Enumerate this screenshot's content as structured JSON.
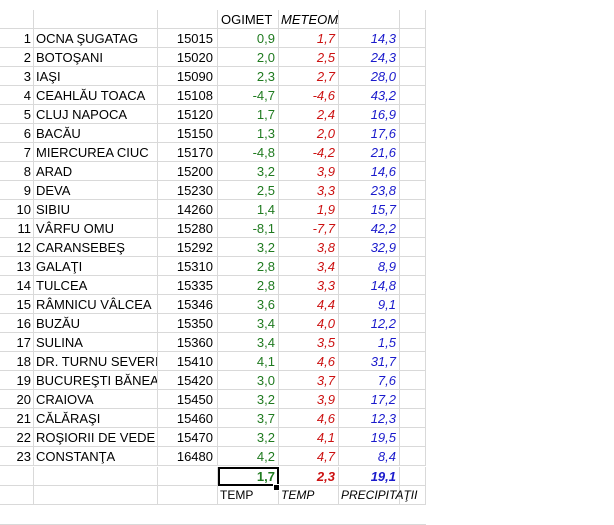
{
  "header": {
    "ogimet_label": "OGIMET",
    "meteomanz_label": "METEOMANZ"
  },
  "rows": [
    {
      "n": "1",
      "station": "OCNA ŞUGATAG",
      "code": "15015",
      "ogimet": "0,9",
      "meteomanz": "1,7",
      "precip": "14,3"
    },
    {
      "n": "2",
      "station": "BOTOŞANI",
      "code": "15020",
      "ogimet": "2,0",
      "meteomanz": "2,5",
      "precip": "24,3"
    },
    {
      "n": "3",
      "station": "IAŞI",
      "code": "15090",
      "ogimet": "2,3",
      "meteomanz": "2,7",
      "precip": "28,0"
    },
    {
      "n": "4",
      "station": "CEAHLĂU TOACA",
      "code": "15108",
      "ogimet": "-4,7",
      "meteomanz": "-4,6",
      "precip": "43,2"
    },
    {
      "n": "5",
      "station": "CLUJ NAPOCA",
      "code": "15120",
      "ogimet": "1,7",
      "meteomanz": "2,4",
      "precip": "16,9"
    },
    {
      "n": "6",
      "station": "BACĂU",
      "code": "15150",
      "ogimet": "1,3",
      "meteomanz": "2,0",
      "precip": "17,6"
    },
    {
      "n": "7",
      "station": "MIERCUREA CIUC",
      "code": "15170",
      "ogimet": "-4,8",
      "meteomanz": "-4,2",
      "precip": "21,6"
    },
    {
      "n": "8",
      "station": "ARAD",
      "code": "15200",
      "ogimet": "3,2",
      "meteomanz": "3,9",
      "precip": "14,6"
    },
    {
      "n": "9",
      "station": "DEVA",
      "code": "15230",
      "ogimet": "2,5",
      "meteomanz": "3,3",
      "precip": "23,8"
    },
    {
      "n": "10",
      "station": "SIBIU",
      "code": "14260",
      "ogimet": "1,4",
      "meteomanz": "1,9",
      "precip": "15,7"
    },
    {
      "n": "11",
      "station": "VÂRFU OMU",
      "code": "15280",
      "ogimet": "-8,1",
      "meteomanz": "-7,7",
      "precip": "42,2"
    },
    {
      "n": "12",
      "station": "CARANSEBEŞ",
      "code": "15292",
      "ogimet": "3,2",
      "meteomanz": "3,8",
      "precip": "32,9"
    },
    {
      "n": "13",
      "station": "GALAŢI",
      "code": "15310",
      "ogimet": "2,8",
      "meteomanz": "3,4",
      "precip": "8,9"
    },
    {
      "n": "14",
      "station": "TULCEA",
      "code": "15335",
      "ogimet": "2,8",
      "meteomanz": "3,3",
      "precip": "14,8"
    },
    {
      "n": "15",
      "station": "RÂMNICU VÂLCEA",
      "code": "15346",
      "ogimet": "3,6",
      "meteomanz": "4,4",
      "precip": "9,1"
    },
    {
      "n": "16",
      "station": "BUZĂU",
      "code": "15350",
      "ogimet": "3,4",
      "meteomanz": "4,0",
      "precip": "12,2"
    },
    {
      "n": "17",
      "station": "SULINA",
      "code": "15360",
      "ogimet": "3,4",
      "meteomanz": "3,5",
      "precip": "1,5"
    },
    {
      "n": "18",
      "station": "DR. TURNU SEVERIN",
      "code": "15410",
      "ogimet": "4,1",
      "meteomanz": "4,6",
      "precip": "31,7"
    },
    {
      "n": "19",
      "station": "BUCUREŞTI BĂNEASA",
      "code": "15420",
      "ogimet": "3,0",
      "meteomanz": "3,7",
      "precip": "7,6"
    },
    {
      "n": "20",
      "station": "CRAIOVA",
      "code": "15450",
      "ogimet": "3,2",
      "meteomanz": "3,9",
      "precip": "17,2"
    },
    {
      "n": "21",
      "station": "CĂLĂRAŞI",
      "code": "15460",
      "ogimet": "3,7",
      "meteomanz": "4,6",
      "precip": "12,3"
    },
    {
      "n": "22",
      "station": "ROŞIORII DE VEDE",
      "code": "15470",
      "ogimet": "3,2",
      "meteomanz": "4,1",
      "precip": "19,5"
    },
    {
      "n": "23",
      "station": "CONSTANŢA",
      "code": "16480",
      "ogimet": "4,2",
      "meteomanz": "4,7",
      "precip": "8,4"
    }
  ],
  "averages": {
    "ogimet": "1,7",
    "meteomanz": "2,3",
    "precip": "19,1"
  },
  "footer": {
    "temp_ogimet": "TEMP",
    "temp_meteomanz": "TEMP",
    "precip": "PRECIPITAŢII"
  },
  "colors": {
    "ogimet": "#1f7a1f",
    "meteomanz": "#cc1111",
    "precip": "#1a1acc",
    "gridline": "#d9d9d9"
  }
}
